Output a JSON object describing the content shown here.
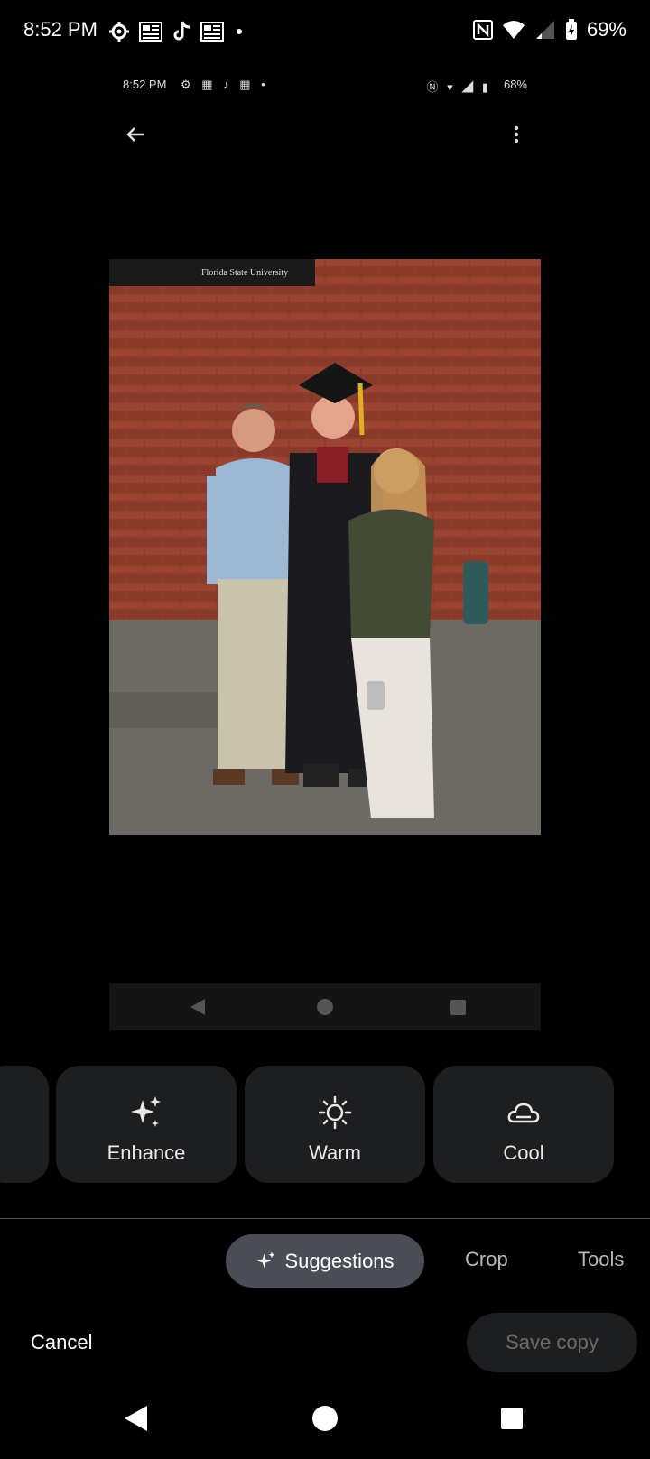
{
  "status_bar": {
    "time": "8:52 PM",
    "battery": "69%"
  },
  "inner_screenshot": {
    "time": "8:52 PM",
    "battery": "68%",
    "photo_sign_text": "Florida State University"
  },
  "suggestions": [
    {
      "label": "Enhance",
      "icon": "sparkle-icon"
    },
    {
      "label": "Warm",
      "icon": "sun-icon"
    },
    {
      "label": "Cool",
      "icon": "cloud-icon"
    }
  ],
  "tabs": {
    "active": "Suggestions",
    "crop": "Crop",
    "tools": "Tools"
  },
  "actions": {
    "cancel": "Cancel",
    "save_copy": "Save copy"
  },
  "colors": {
    "background": "#000000",
    "card": "#1d1e20",
    "active_tab": "#4a4d55",
    "disabled_text": "#6b6b6b"
  }
}
